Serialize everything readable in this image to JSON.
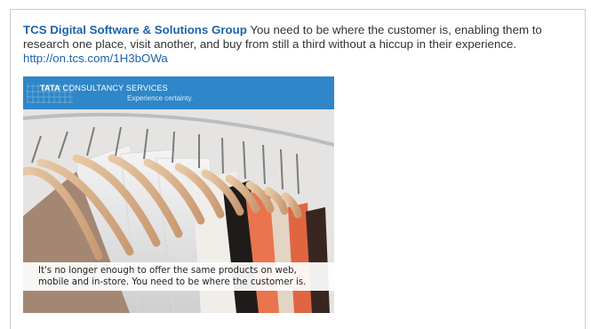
{
  "post": {
    "author": "TCS Digital Software & Solutions Group",
    "message": " You need to be where the customer is, enabling them to research one place, visit another, and buy from still a third without a hiccup in their experience.",
    "link": "http://on.tcs.com/1H3bOWa"
  },
  "image": {
    "brand_prefix": "TATA",
    "brand_suffix": " CONSULTANCY SERVICES",
    "tagline": "Experience certainty.",
    "caption": "It's no longer enough to offer the same products on web, mobile and in-store. You need to be where the customer is."
  }
}
